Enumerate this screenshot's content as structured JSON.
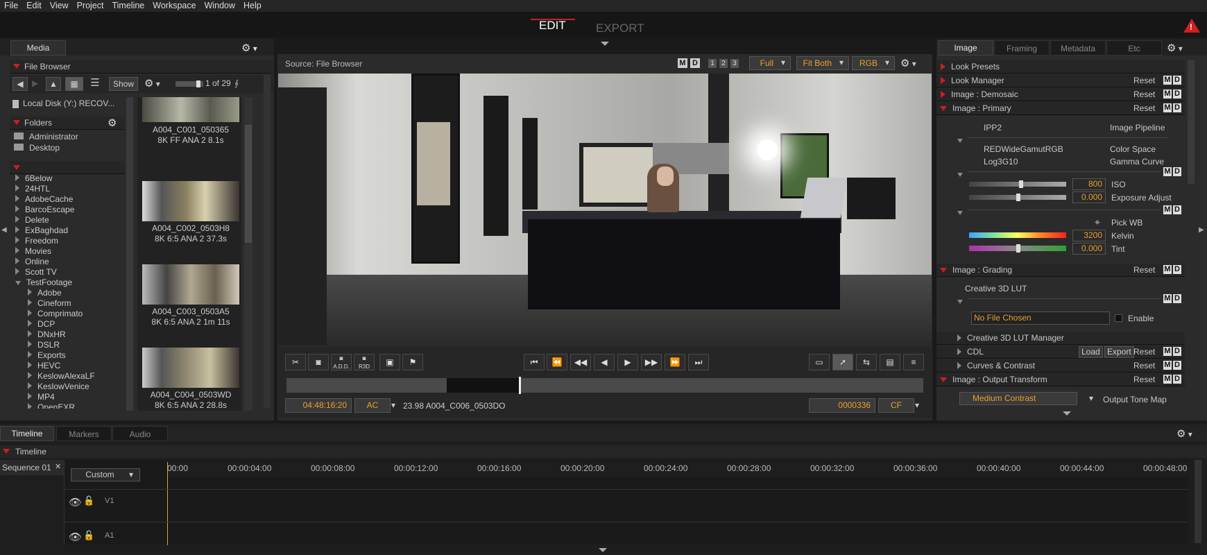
{
  "menu": [
    "File",
    "Edit",
    "View",
    "Project",
    "Timeline",
    "Workspace",
    "Window",
    "Help"
  ],
  "mode_tabs": {
    "edit": "EDIT",
    "export": "EXPORT"
  },
  "left": {
    "tab": "Media",
    "file_browser": "File Browser",
    "show_label": "Show",
    "count": "1 of 29",
    "disk": "Local Disk (Y:) RECOV...",
    "folders_label": "Folders",
    "folders": [
      "Administrator",
      "Desktop"
    ],
    "tree": [
      "6Below",
      "24HTL",
      "AdobeCache",
      "BarcoEscape",
      "Delete",
      "ExBaghdad",
      "Freedom",
      "Movies",
      "Online",
      "Scott TV",
      "TestFootage"
    ],
    "subtree": [
      "Adobe",
      "Cineform",
      "Comprimato",
      "DCP",
      "DNxHR",
      "DSLR",
      "Exports",
      "HEVC",
      "KeslowAlexaLF",
      "KeslowVenice",
      "MP4",
      "OpenEXR"
    ],
    "clips": [
      {
        "name": "A004_C001_050365",
        "info": "8K FF ANA 2   8.1s"
      },
      {
        "name": "A004_C002_0503H8",
        "info": "8K 6:5 ANA 2   37.3s"
      },
      {
        "name": "A004_C003_0503A5",
        "info": "8K 6:5 ANA 2   1m 11s"
      },
      {
        "name": "A004_C004_0503WD",
        "info": "8K 6:5 ANA 2   28.8s"
      }
    ]
  },
  "viewer": {
    "source": "Source: File Browser",
    "m": "M",
    "d": "D",
    "n1": "1",
    "n2": "2",
    "n3": "3",
    "full": "Full",
    "fit": "Fit Both",
    "rgb": "RGB",
    "timecode": "04:48:16:20",
    "ac": "AC",
    "clip_info": "23.98 A004_C006_0503DO",
    "frame": "0000336",
    "cf": "CF",
    "add_label": "A.D.D.",
    "r3d_label": "R3D"
  },
  "right": {
    "tabs": [
      "Image",
      "Framing",
      "Metadata",
      "Etc"
    ],
    "look_presets": "Look Presets",
    "look_manager": "Look Manager",
    "demosaic": "Image : Demosaic",
    "primary": "Image : Primary",
    "reset": "Reset",
    "ipp2": "IPP2",
    "image_pipeline": "Image Pipeline",
    "gamut": "REDWideGamutRGB",
    "color_space": "Color Space",
    "log": "Log3G10",
    "gamma": "Gamma Curve",
    "iso_val": "800",
    "iso": "ISO",
    "exp_val": "0.000",
    "exp": "Exposure Adjust",
    "pickwb": "Pick WB",
    "kelvin_val": "3200",
    "kelvin": "Kelvin",
    "tint_val": "0.000",
    "tint": "Tint",
    "grading": "Image : Grading",
    "lut": "Creative 3D LUT",
    "no_file": "No File Chosen",
    "enable": "Enable",
    "lut_manager": "Creative 3D LUT Manager",
    "cdl": "CDL",
    "load": "Load",
    "export": "Export",
    "curves": "Curves & Contrast",
    "output": "Image : Output Transform",
    "medium": "Medium Contrast",
    "tone_map": "Output Tone Map"
  },
  "bottom": {
    "tabs": [
      "Timeline",
      "Markers",
      "Audio"
    ],
    "timeline_label": "Timeline",
    "sequence": "Sequence 01",
    "custom": "Custom",
    "v1": "V1",
    "a1": "A1",
    "ticks": [
      "00:00",
      "00:00:04:00",
      "00:00:08:00",
      "00:00:12:00",
      "00:00:16:00",
      "00:00:20:00",
      "00:00:24:00",
      "00:00:28:00",
      "00:00:32:00",
      "00:00:36:00",
      "00:00:40:00",
      "00:00:44:00",
      "00:00:48:00"
    ]
  },
  "colors": {
    "accent": "#e8a030",
    "red": "#c82020"
  }
}
